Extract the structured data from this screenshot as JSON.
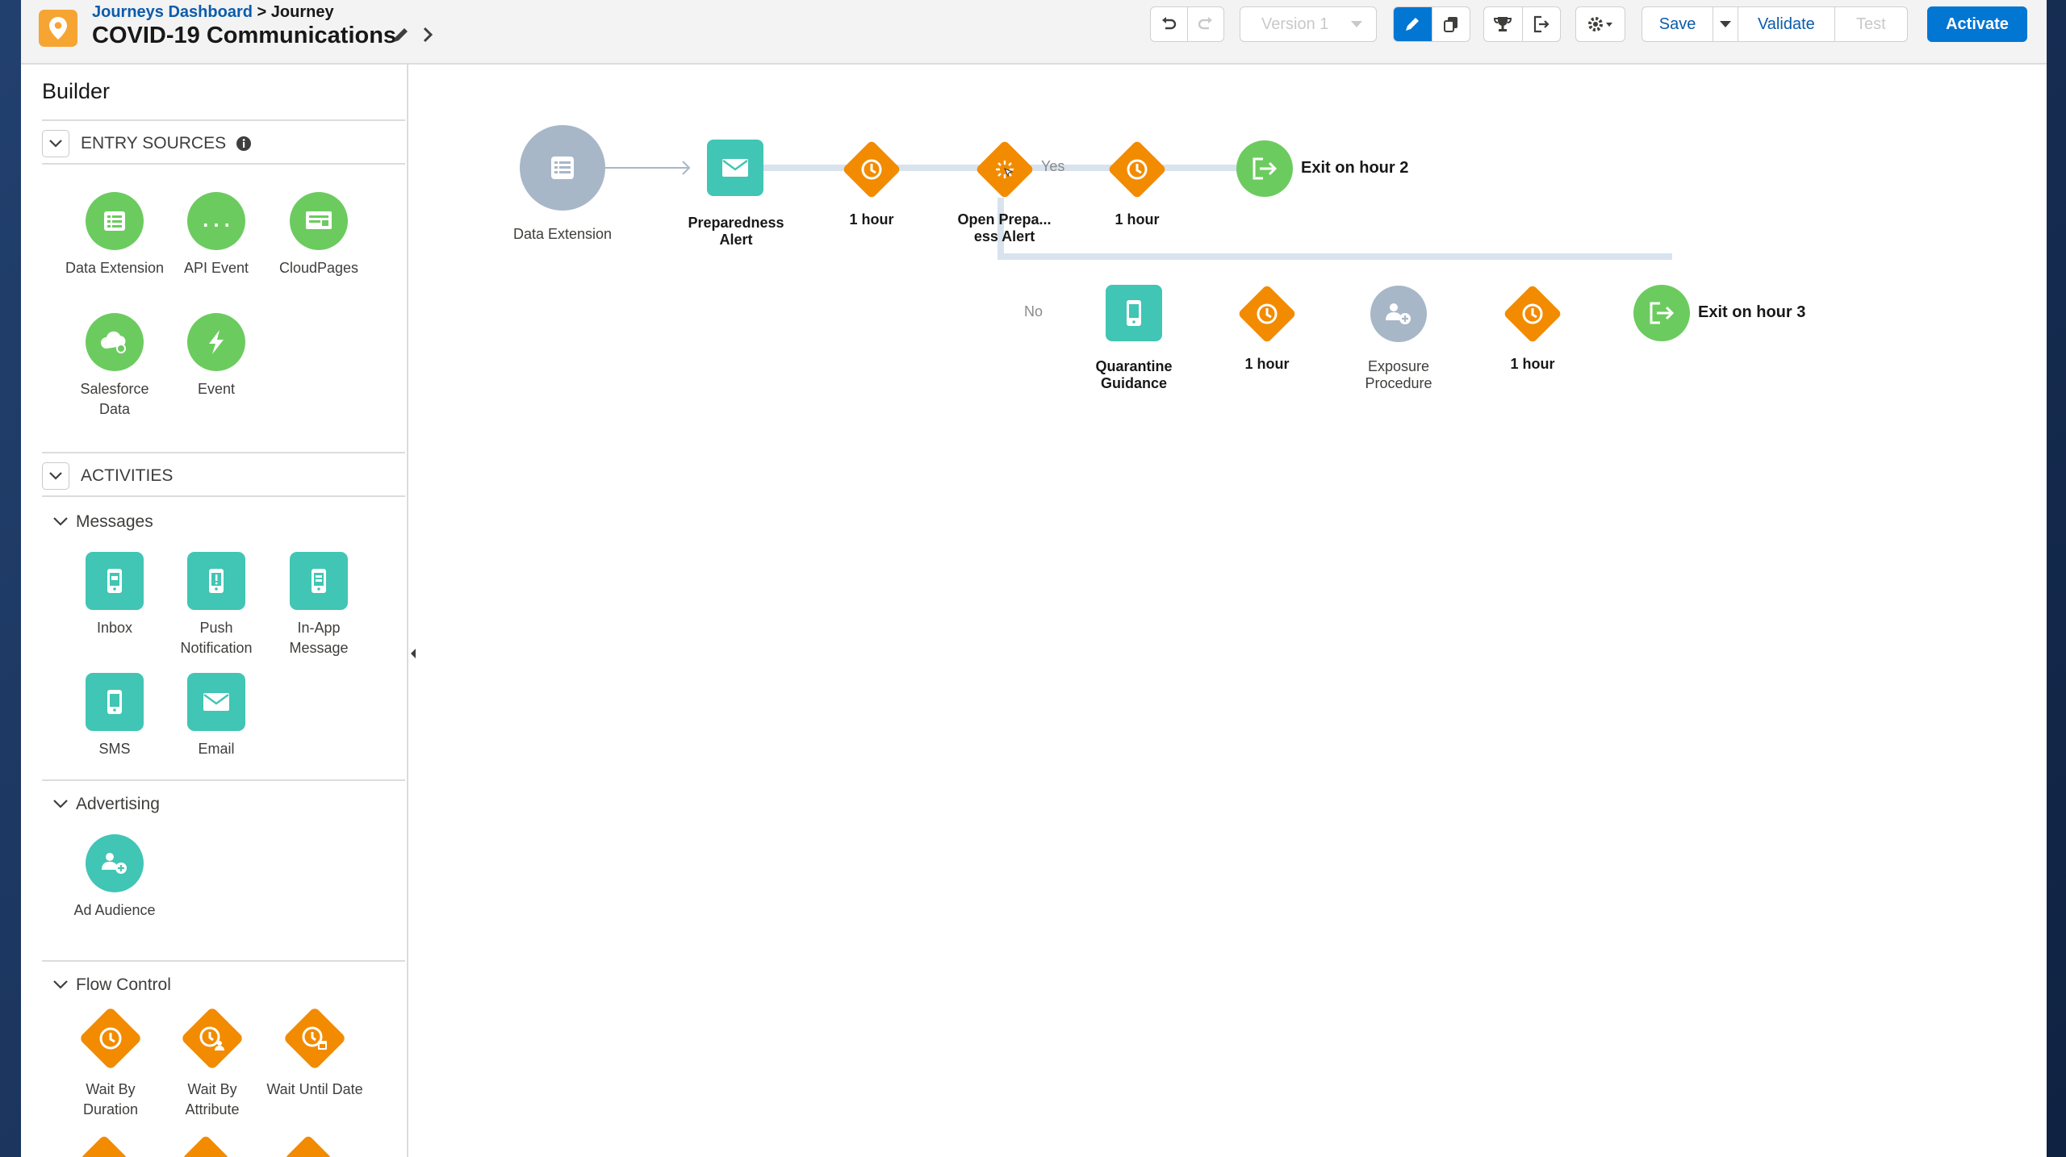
{
  "header": {
    "breadcrumb_link": "Journeys Dashboard",
    "breadcrumb_sep": ">",
    "breadcrumb_current": "Journey",
    "title": "COVID-19 Communications",
    "version": "Version 1",
    "save_label": "Save",
    "validate_label": "Validate",
    "test_label": "Test",
    "activate_label": "Activate"
  },
  "sidebar": {
    "title": "Builder",
    "entry_sources": {
      "label": "ENTRY SOURCES",
      "items": [
        {
          "label": "Data Extension",
          "icon": "data-extension-icon"
        },
        {
          "label": "API Event",
          "icon": "api-event-icon"
        },
        {
          "label": "CloudPages",
          "icon": "cloudpages-icon"
        },
        {
          "label": "Salesforce Data",
          "icon": "salesforce-data-icon"
        },
        {
          "label": "Event",
          "icon": "event-icon"
        }
      ]
    },
    "activities": {
      "label": "ACTIVITIES",
      "messages": {
        "label": "Messages",
        "items": [
          {
            "label": "Inbox",
            "icon": "inbox-icon"
          },
          {
            "label": "Push Notification",
            "icon": "push-notification-icon"
          },
          {
            "label": "In-App Message",
            "icon": "in-app-message-icon"
          },
          {
            "label": "SMS",
            "icon": "sms-icon"
          },
          {
            "label": "Email",
            "icon": "email-icon"
          }
        ]
      },
      "advertising": {
        "label": "Advertising",
        "items": [
          {
            "label": "Ad Audience",
            "icon": "ad-audience-icon"
          }
        ]
      },
      "flow_control": {
        "label": "Flow Control",
        "items": [
          {
            "label": "Wait By Duration",
            "icon": "wait-duration-icon"
          },
          {
            "label": "Wait By Attribute",
            "icon": "wait-attribute-icon"
          },
          {
            "label": "Wait Until Date",
            "icon": "wait-date-icon"
          }
        ]
      }
    }
  },
  "canvas": {
    "entry": {
      "label": "Data Extension"
    },
    "top_path": [
      {
        "label": "Preparedness Alert",
        "type": "email"
      },
      {
        "label": "1 hour",
        "type": "wait"
      },
      {
        "label": "Open Prepa... ess Alert",
        "type": "decision"
      },
      {
        "label": "1 hour",
        "type": "wait"
      },
      {
        "label": "Exit on hour 2",
        "type": "exit"
      }
    ],
    "yes_label": "Yes",
    "no_label": "No",
    "bottom_path": [
      {
        "label": "Quarantine Guidance",
        "type": "sms"
      },
      {
        "label": "1 hour",
        "type": "wait"
      },
      {
        "label": "Exposure Procedure",
        "type": "ad-audience"
      },
      {
        "label": "1 hour",
        "type": "wait"
      },
      {
        "label": "Exit on hour 3",
        "type": "exit"
      }
    ]
  },
  "colors": {
    "brand_blue": "#0176d3",
    "entry_green": "#6ccb5f",
    "message_teal": "#41c5b4",
    "wait_orange": "#f28b00",
    "gray_node": "#a8b7c7"
  }
}
